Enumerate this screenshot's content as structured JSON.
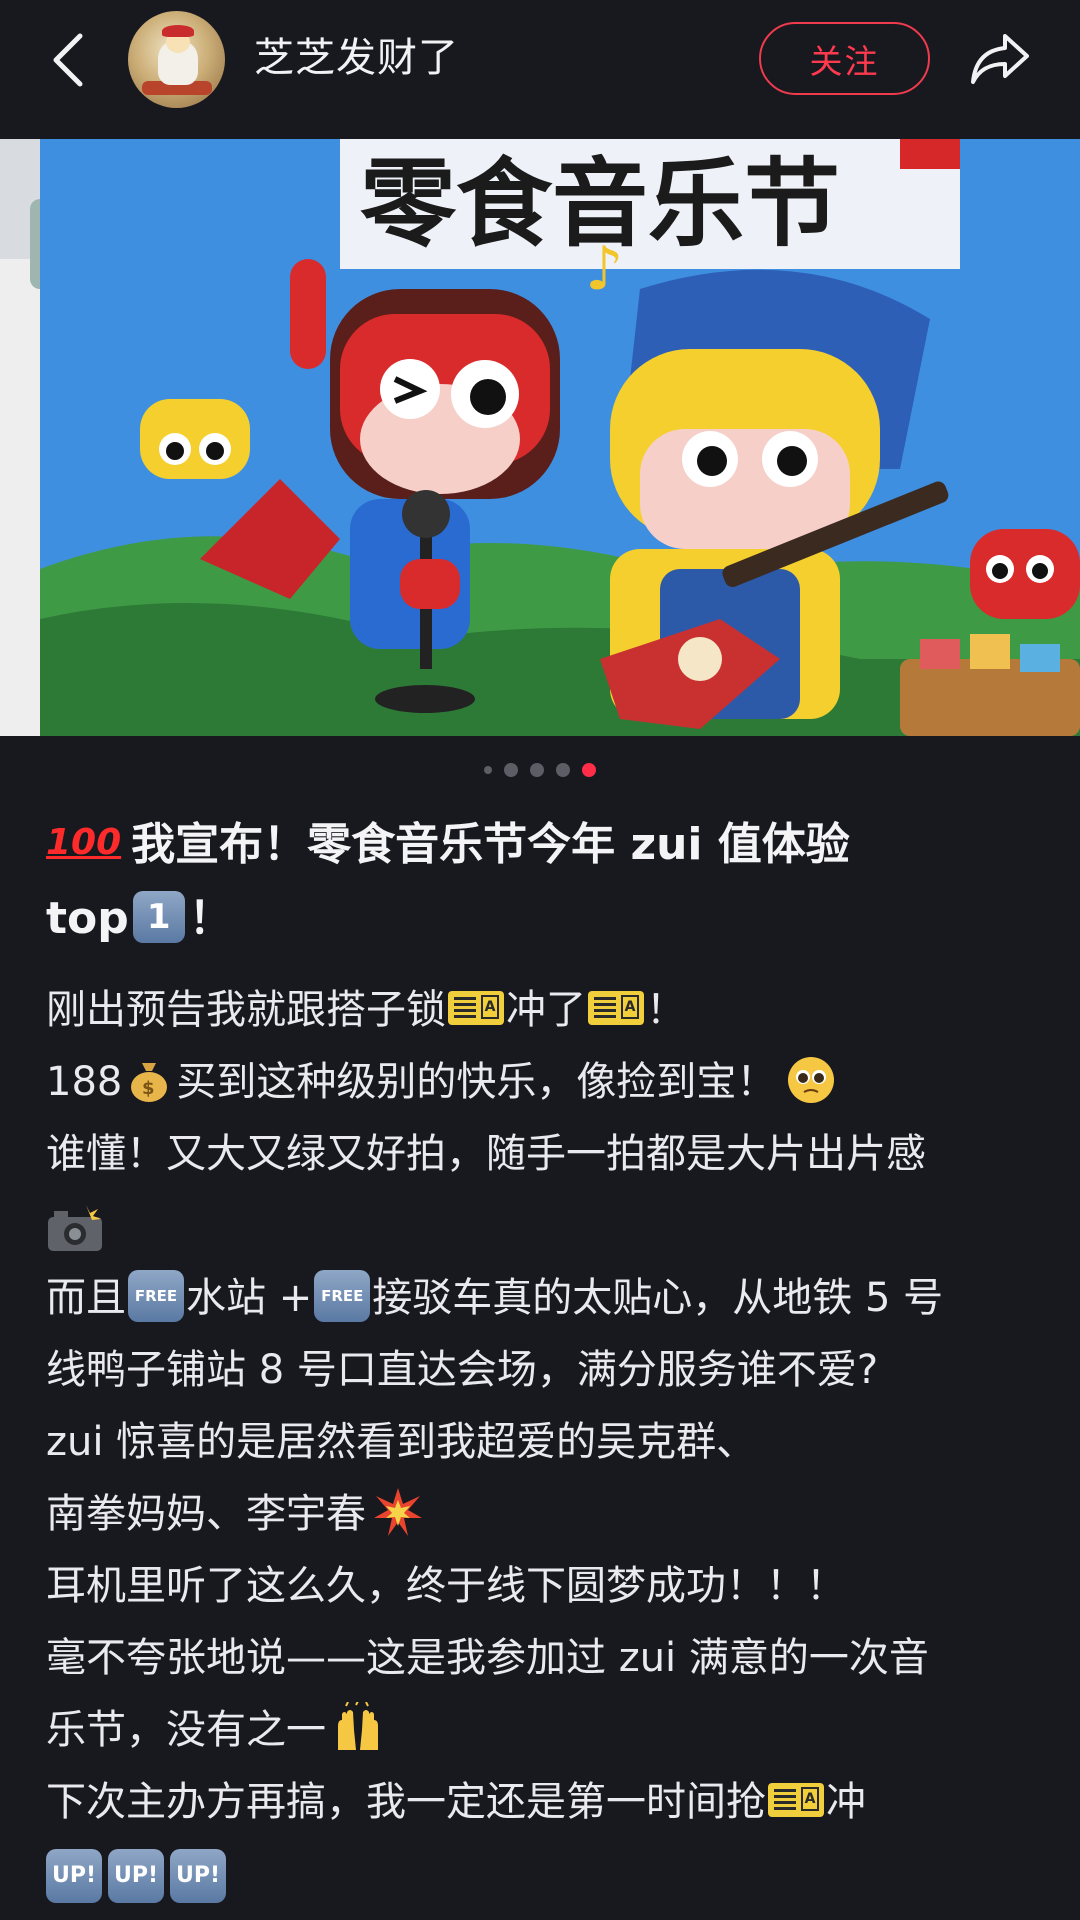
{
  "header": {
    "username": "芝芝发财了",
    "follow_label": "关注",
    "back_icon": "chevron-left-icon",
    "share_icon": "share-arrow-icon"
  },
  "carousel": {
    "total": 5,
    "active_index": 4,
    "image_text": "零食音乐节"
  },
  "post": {
    "title_line1": "我宣布！零食音乐节今年 zui 值体验",
    "title_line2_prefix": "top",
    "title_line2_key": "1",
    "title_line2_suffix": "！",
    "hundred_emoji": "100",
    "lines": {
      "l1a": "刚出预告我就跟搭子锁",
      "l1b": "冲了",
      "l1c": "！",
      "l2a": "188",
      "l2b": "买到这种级别的快乐，像捡到宝！",
      "l3": "谁懂！又大又绿又好拍，随手一拍都是大片出片感",
      "l5a": "而且",
      "l5b": "水站 +",
      "l5c": "接驳车真的太贴心，从地铁 5 号",
      "l6": "线鸭子铺站 8 号口直达会场，满分服务谁不爱?",
      "l7": "zui 惊喜的是居然看到我超爱的吴克群、",
      "l8": "南拳妈妈、李宇春",
      "l9": "耳机里听了这么久，终于线下圆梦成功！！！",
      "l10": "毫不夸张地说——这是我参加过 zui 满意的一次音",
      "l11": "乐节，没有之一",
      "l12a": "下次主办方再搞，我一定还是第一时间抢",
      "l12b": "冲"
    },
    "free_label": "FREE",
    "up_label": "UP!"
  },
  "colors": {
    "background": "#18181f",
    "accent": "#ff2d48",
    "text": "#ececef"
  }
}
